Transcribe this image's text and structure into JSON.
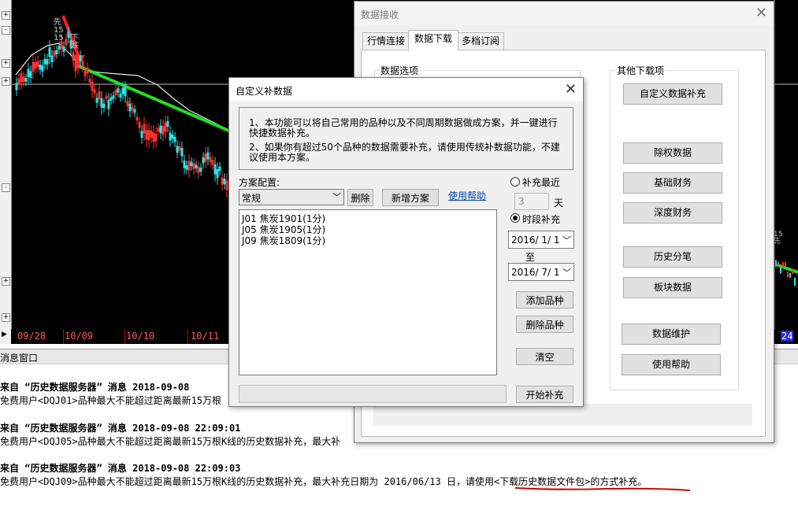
{
  "chart": {
    "left_buttons": [
      "+",
      "-",
      "+",
      "+",
      "-",
      "+",
      "+"
    ],
    "date_labels": [
      "09/28",
      "10/09",
      "10/10",
      "10/11"
    ],
    "right_date_label": "24",
    "annotations_left": [
      "先",
      "15",
      "15",
      "下跌"
    ],
    "annotations_right": [
      "先",
      "15",
      "十"
    ]
  },
  "message_window": {
    "title": "消息窗口",
    "messages": [
      {
        "header": "来自 “历史数据服务器” 消息 2018-09-08",
        "body": "免费用户<DQJ01>品种最大不能超过距离最新15万根"
      },
      {
        "header": "来自 “历史数据服务器” 消息 2018-09-08 22:09:01",
        "body": "免费用户<DQJ05>品种最大不能超过距离最新15万根K线的历史数据补充，最大补"
      },
      {
        "header": "来自 “历史数据服务器” 消息 2018-09-08 22:09:03",
        "body": "免费用户<DQJ09>品种最大不能超过距离最新15万根K线的历史数据补充，最大补充日期为 2016/06/13 日，请使用<下载历史数据文件包>的方式补充。"
      }
    ],
    "underline_color": "#d00000"
  },
  "data_receive": {
    "title": "数据接收",
    "close": "✕",
    "tabs": [
      "行情连接",
      "数据下载",
      "多档订阅"
    ],
    "active_tab": "数据下载",
    "group_data_options": "数据选项",
    "group_other": "其他下载项",
    "buttons": [
      "自定义数据补充",
      "除权数据",
      "基础财务",
      "深度财务",
      "历史分笔",
      "板块数据",
      "数据维护",
      "使用帮助"
    ]
  },
  "custom_dialog": {
    "title": "自定义补数据",
    "close": "✕",
    "info_line1": "1、本功能可以将自己常用的品种以及不同周期数据做成方案，并一键进行快捷数据补充。",
    "info_line2": "2、如果你有超过50个品种的数据需要补充，请使用传统补数据功能，不建议使用本方案。",
    "scheme_label": "方案配置:",
    "scheme_value": "常规",
    "delete_button": "删除",
    "new_scheme_button": "新增方案",
    "help_link": "使用帮助",
    "list_items": [
      "J01 焦炭1901(1分)",
      "J05 焦炭1905(1分)",
      "J09 焦炭1809(1分)"
    ],
    "radio_recent_label": "补充最近",
    "recent_days": "3",
    "days_unit": "天",
    "radio_period_label": "时段补充",
    "period_selected": true,
    "date_from": "2016/ 1/ 1",
    "date_to_label": "至",
    "date_to": "2016/ 7/ 1",
    "add_button": "添加品种",
    "remove_button": "删除品种",
    "clear_button": "清空",
    "start_button": "开始补充"
  }
}
